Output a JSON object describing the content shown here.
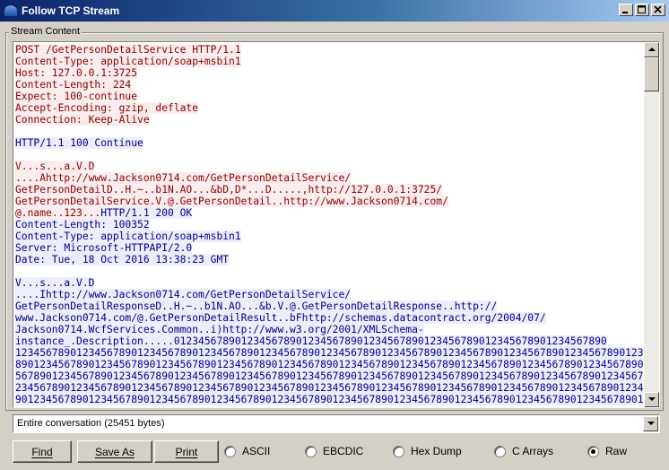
{
  "window": {
    "title": "Follow TCP Stream"
  },
  "group": {
    "label": "Stream Content"
  },
  "stream_lines": [
    {
      "dir": "client",
      "text": "POST /GetPersonDetailService HTTP/1.1"
    },
    {
      "dir": "client",
      "text": "Content-Type: application/soap+msbin1"
    },
    {
      "dir": "client",
      "text": "Host: 127.0.0.1:3725"
    },
    {
      "dir": "client",
      "text": "Content-Length: 224"
    },
    {
      "dir": "client",
      "text": "Expect: 100-continue"
    },
    {
      "dir": "client",
      "text": "Accept-Encoding: gzip, deflate"
    },
    {
      "dir": "client",
      "text": "Connection: Keep-Alive"
    },
    {
      "dir": "blank",
      "text": ""
    },
    {
      "dir": "server",
      "text": "HTTP/1.1 100 Continue"
    },
    {
      "dir": "blank",
      "text": ""
    },
    {
      "dir": "client",
      "text": "V...s...a.V.D"
    },
    {
      "dir": "client",
      "text": "....Ahttp://www.Jackson0714.com/GetPersonDetailService/"
    },
    {
      "dir": "client",
      "text": "GetPersonDetailD..H.~..b1N.AO...&bD,D*...D.....,http://127.0.0.1:3725/"
    },
    {
      "dir": "client",
      "text": "GetPersonDetailService.V.@.GetPersonDetail..http://www.Jackson0714.com/"
    },
    {
      "dir": "mixed",
      "client": "@.name..123...",
      "server": "HTTP/1.1 200 OK"
    },
    {
      "dir": "server",
      "text": "Content-Length: 100352"
    },
    {
      "dir": "server",
      "text": "Content-Type: application/soap+msbin1"
    },
    {
      "dir": "server",
      "text": "Server: Microsoft-HTTPAPI/2.0"
    },
    {
      "dir": "server",
      "text": "Date: Tue, 18 Oct 2016 13:38:23 GMT"
    },
    {
      "dir": "blank",
      "text": ""
    },
    {
      "dir": "server",
      "text": "V...s...a.V.D"
    },
    {
      "dir": "server",
      "text": "....Ihttp://www.Jackson0714.com/GetPersonDetailService/"
    },
    {
      "dir": "server",
      "text": "GetPersonDetailResponseD..H.~..b1N.AO...&b.V.@.GetPersonDetailResponse..http://"
    },
    {
      "dir": "server",
      "text": "www.Jackson0714.com/@.GetPersonDetailResult..bFhttp://schemas.datacontract.org/2004/07/"
    },
    {
      "dir": "server",
      "text": "Jackson0714.WcfServices.Common..i)http://www.w3.org/2001/XMLSchema-"
    },
    {
      "dir": "server",
      "text": "instance_.Description.....01234567890123456789012345678901234567890123456789012345678901234567890"
    },
    {
      "dir": "server",
      "text": "123456789012345678901234567890123456789012345678901234567890123456789012345678901234567890123456789012345678901234567"
    },
    {
      "dir": "server",
      "text": "890123456789012345678901234567890123456789012345678901234567890123456789012345678901234567890123456789012345678901234"
    },
    {
      "dir": "server",
      "text": "567890123456789012345678901234567890123456789012345678901234567890123456789012345678901234567890123456789012345678901"
    },
    {
      "dir": "server",
      "text": "234567890123456789012345678901234567890123456789012345678901234567890123456789012345678901234567890123456789012345678"
    },
    {
      "dir": "server",
      "text": "901234567890123456789012345678901234567890123456789012345678901234567890123456789012345678901234567890123456789012345"
    }
  ],
  "conversation_select": {
    "value": "Entire conversation (25451 bytes)"
  },
  "buttons": {
    "find": "Find",
    "save_as": "Save As",
    "print": "Print"
  },
  "format_options": [
    {
      "label": "ASCII",
      "checked": false
    },
    {
      "label": "EBCDIC",
      "checked": false
    },
    {
      "label": "Hex Dump",
      "checked": false
    },
    {
      "label": "C Arrays",
      "checked": false
    },
    {
      "label": "Raw",
      "checked": true
    }
  ],
  "colors": {
    "client_fg": "#8b0000",
    "client_bg": "#fbeded",
    "server_fg": "#00008b",
    "server_bg": "#ededfb",
    "titlebar": "#0a246a"
  },
  "icons": [
    "wireshark-fin-icon",
    "minimize-icon",
    "maximize-icon",
    "close-icon",
    "scroll-up-icon",
    "scroll-down-icon",
    "dropdown-arrow-icon"
  ]
}
